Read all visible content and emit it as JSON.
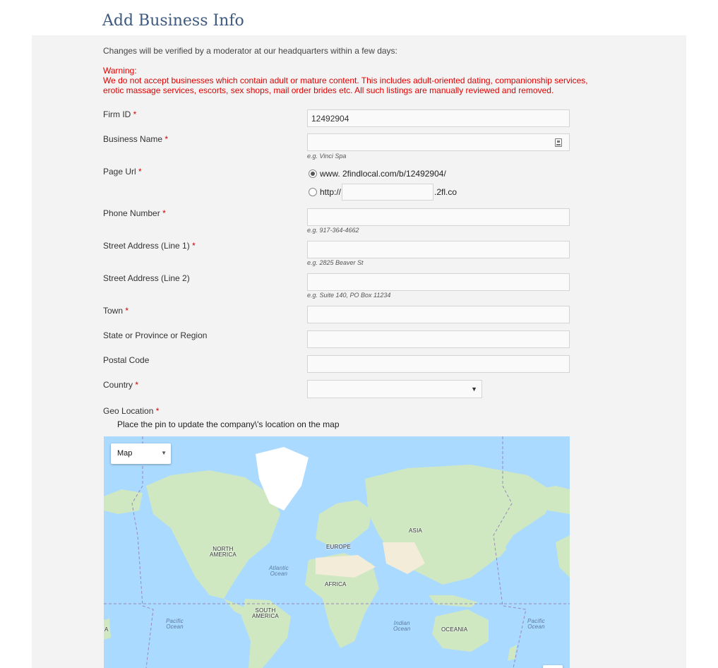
{
  "page": {
    "title": "Add Business Info"
  },
  "intro_text": "Changes will be verified by a moderator at our headquarters within a few days:",
  "warning": {
    "heading": "Warning:",
    "line1": "We do not accept businesses which contain adult or mature content. This includes adult-oriented dating, companionship services,",
    "line2": "erotic massage services, escorts, sex shops, mail order brides etc. All such listings are manually reviewed and removed."
  },
  "form": {
    "required_mark": "*",
    "firm_id": {
      "label": "Firm ID",
      "value": "12492904"
    },
    "business_name": {
      "label": "Business Name",
      "value": "",
      "hint": "e.g. Vinci Spa"
    },
    "page_url": {
      "label": "Page Url",
      "option1": "www. 2findlocal.com/b/12492904/",
      "option2_prefix": "http://",
      "option2_suffix": ".2fl.co",
      "selected": "option1"
    },
    "phone": {
      "label": "Phone Number",
      "value": "",
      "hint": "e.g. 917-364-4662"
    },
    "street1": {
      "label": "Street Address (Line 1)",
      "value": "",
      "hint": "e.g. 2825 Beaver St"
    },
    "street2": {
      "label": "Street Address (Line 2)",
      "value": "",
      "hint": "e.g. Suite 140, PO Box 11234"
    },
    "town": {
      "label": "Town",
      "value": ""
    },
    "state": {
      "label": "State or Province or Region",
      "value": ""
    },
    "postal": {
      "label": "Postal Code",
      "value": ""
    },
    "country": {
      "label": "Country",
      "selected": "",
      "caret": "▼"
    },
    "geo": {
      "label": "Geo Location",
      "hint": "Place the pin to update the company\\'s location on the map"
    }
  },
  "map": {
    "type_label": "Map",
    "type_caret": "▼",
    "labels": {
      "north_america_1": "NORTH",
      "north_america_2": "AMERICA",
      "europe": "EUROPE",
      "asia": "ASIA",
      "africa": "AFRICA",
      "south_america_1": "SOUTH",
      "south_america_2": "AMERICA",
      "oceania": "OCEANIA",
      "atlantic_1": "Atlantic",
      "atlantic_2": "Ocean",
      "indian_1": "Indian",
      "indian_2": "Ocean",
      "pacific_left_1": "Pacific",
      "pacific_left_2": "Ocean",
      "pacific_right_1": "Pacific",
      "pacific_right_2": "Ocean",
      "left_edge": "A"
    },
    "colors": {
      "water": "#aadaff",
      "land": "#cfe8c2",
      "ice": "#ffffff",
      "desert": "#f2ecd8",
      "border": "#9b88b8"
    }
  }
}
